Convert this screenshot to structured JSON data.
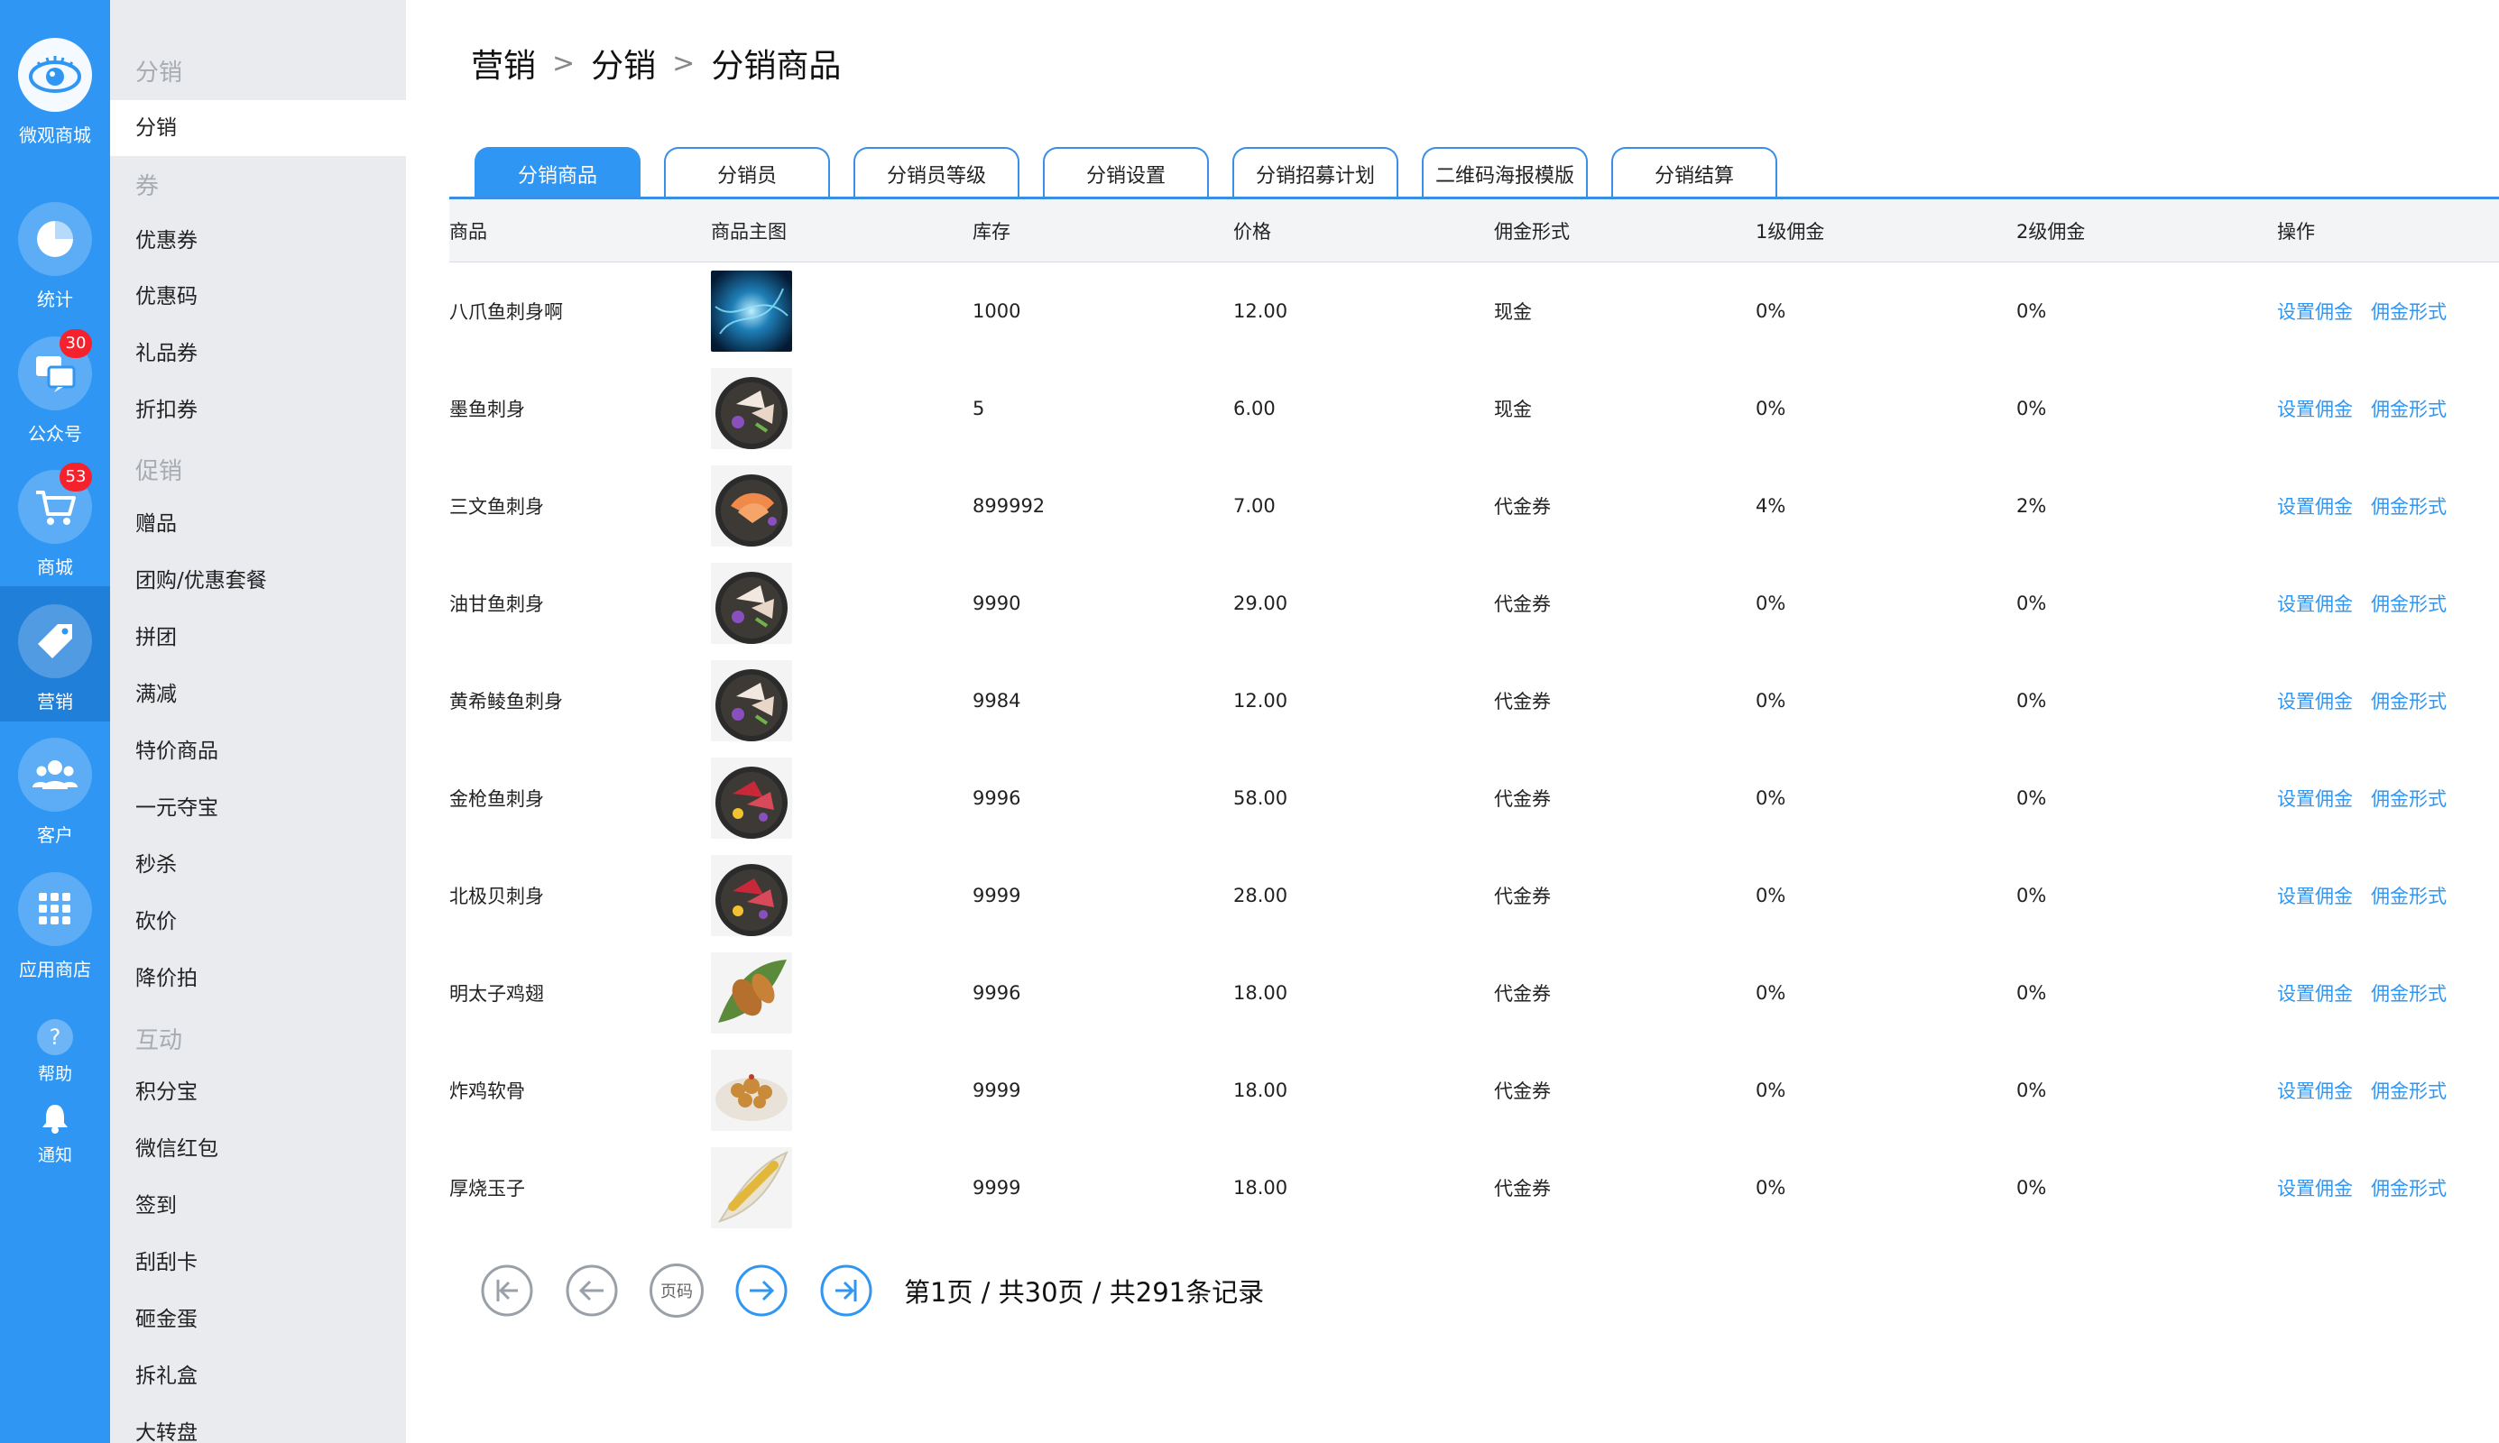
{
  "rail": {
    "items": [
      {
        "label": "微观商城",
        "icon": "eye-logo-icon"
      },
      {
        "label": "统计",
        "icon": "pie-chart-icon"
      },
      {
        "label": "公众号",
        "icon": "chat-bubbles-icon",
        "badge": "30"
      },
      {
        "label": "商城",
        "icon": "shopping-cart-icon",
        "badge": "53"
      },
      {
        "label": "营销",
        "icon": "tag-icon",
        "active": true
      },
      {
        "label": "客户",
        "icon": "users-icon"
      },
      {
        "label": "应用商店",
        "icon": "apps-grid-icon"
      }
    ],
    "help_label": "帮助",
    "notice_label": "通知"
  },
  "subnav": {
    "groups": [
      {
        "title": "分销",
        "items": [
          "分销"
        ]
      },
      {
        "title": "券",
        "items": [
          "优惠券",
          "优惠码",
          "礼品券",
          "折扣券"
        ]
      },
      {
        "title": "促销",
        "items": [
          "赠品",
          "团购/优惠套餐",
          "拼团",
          "满减",
          "特价商品",
          "一元夺宝",
          "秒杀",
          "砍价",
          "降价拍"
        ]
      },
      {
        "title": "互动",
        "items": [
          "积分宝",
          "微信红包",
          "签到",
          "刮刮卡",
          "砸金蛋",
          "拆礼盒",
          "大转盘"
        ]
      }
    ],
    "active_item": "分销"
  },
  "breadcrumb": [
    "营销",
    "分销",
    "分销商品"
  ],
  "tabs": [
    {
      "label": "分销商品",
      "active": true
    },
    {
      "label": "分销员"
    },
    {
      "label": "分销员等级"
    },
    {
      "label": "分销设置"
    },
    {
      "label": "分销招募计划"
    },
    {
      "label": "二维码海报模版"
    },
    {
      "label": "分销结算"
    }
  ],
  "table": {
    "headers": [
      "商品",
      "商品主图",
      "库存",
      "价格",
      "佣金形式",
      "1级佣金",
      "2级佣金",
      "操作"
    ],
    "action_labels": [
      "设置佣金",
      "佣金形式"
    ],
    "rows": [
      {
        "name": "八爪鱼刺身啊",
        "image": "blue-swirl",
        "stock": "1000",
        "price": "12.00",
        "type": "现金",
        "l1": "0%",
        "l2": "0%"
      },
      {
        "name": "墨鱼刺身",
        "image": "sashimi-plate",
        "stock": "5",
        "price": "6.00",
        "type": "现金",
        "l1": "0%",
        "l2": "0%"
      },
      {
        "name": "三文鱼刺身",
        "image": "salmon-plate",
        "stock": "899992",
        "price": "7.00",
        "type": "代金券",
        "l1": "4%",
        "l2": "2%"
      },
      {
        "name": "油甘鱼刺身",
        "image": "sashimi-plate",
        "stock": "9990",
        "price": "29.00",
        "type": "代金券",
        "l1": "0%",
        "l2": "0%"
      },
      {
        "name": "黄希鲮鱼刺身",
        "image": "sashimi-plate",
        "stock": "9984",
        "price": "12.00",
        "type": "代金券",
        "l1": "0%",
        "l2": "0%"
      },
      {
        "name": "金枪鱼刺身",
        "image": "tuna-plate",
        "stock": "9996",
        "price": "58.00",
        "type": "代金券",
        "l1": "0%",
        "l2": "0%"
      },
      {
        "name": "北极贝刺身",
        "image": "tuna-plate",
        "stock": "9999",
        "price": "28.00",
        "type": "代金券",
        "l1": "0%",
        "l2": "0%"
      },
      {
        "name": "明太子鸡翅",
        "image": "chicken-wing",
        "stock": "9996",
        "price": "18.00",
        "type": "代金券",
        "l1": "0%",
        "l2": "0%"
      },
      {
        "name": "炸鸡软骨",
        "image": "fried-chicken",
        "stock": "9999",
        "price": "18.00",
        "type": "代金券",
        "l1": "0%",
        "l2": "0%"
      },
      {
        "name": "厚烧玉子",
        "image": "tamago-boat",
        "stock": "9999",
        "price": "18.00",
        "type": "代金券",
        "l1": "0%",
        "l2": "0%"
      }
    ]
  },
  "pagination": {
    "page_button_label": "页码",
    "info": "第1页 / 共30页 / 共291条记录"
  },
  "colors": {
    "accent": "#2f96f3",
    "rail_bg": "#2f96f3",
    "subnav_bg": "#e9ebee",
    "badge": "#f5222d"
  }
}
